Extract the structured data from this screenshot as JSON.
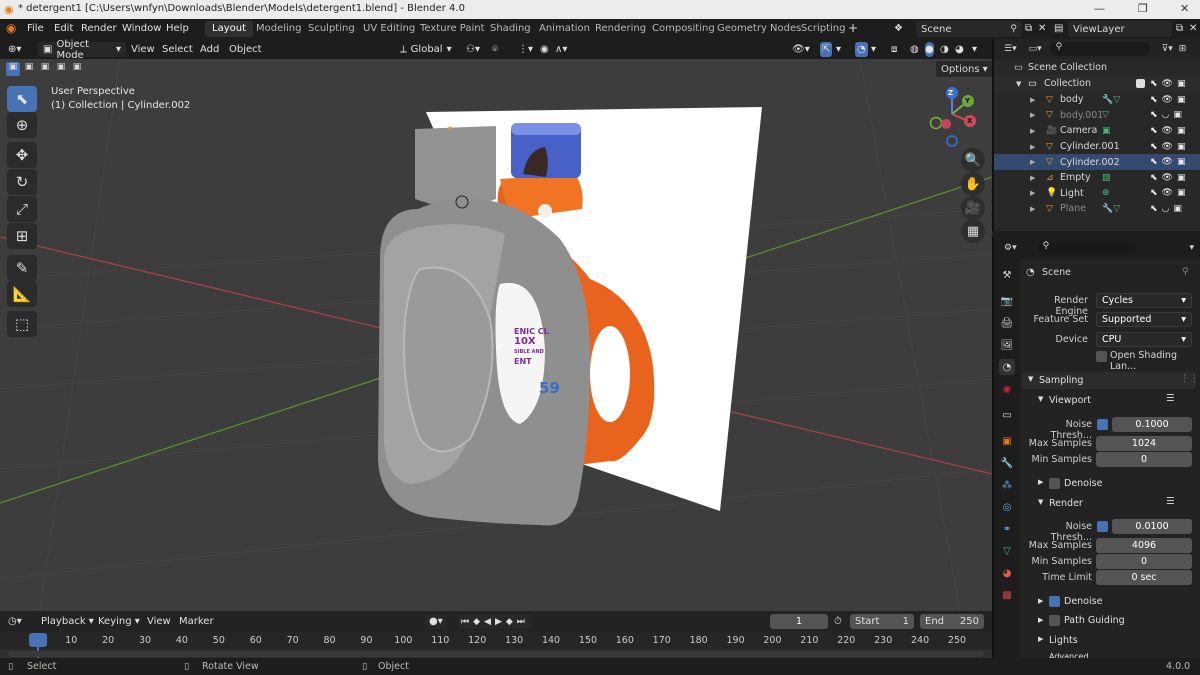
{
  "window": {
    "title": "* detergent1 [C:\\Users\\wnfyn\\Downloads\\Blender\\Models\\detergent1.blend] - Blender 4.0"
  },
  "menu": [
    "File",
    "Edit",
    "Render",
    "Window",
    "Help"
  ],
  "workspaces": [
    "Layout",
    "Modeling",
    "Sculpting",
    "UV Editing",
    "Texture Paint",
    "Shading",
    "Animation",
    "Rendering",
    "Compositing",
    "Geometry Nodes",
    "Scripting"
  ],
  "scene": {
    "name": "Scene",
    "view_layer": "ViewLayer"
  },
  "viewport_header": {
    "mode": "Object Mode",
    "menus": [
      "View",
      "Select",
      "Add",
      "Object"
    ],
    "transform": "Global",
    "options": "Options"
  },
  "viewport": {
    "info_line1": "User Perspective",
    "info_line2": "(1) Collection | Cylinder.002",
    "gizmo": {
      "z": "Z",
      "y": "Y",
      "x": "X"
    },
    "label_fragments": [
      "ENIC CL",
      "10X",
      "SIBLE AND",
      "ENT",
      "59"
    ]
  },
  "outliner": {
    "root": "Scene Collection",
    "collection": "Collection",
    "items": [
      {
        "name": "body",
        "color": "#e49a3a",
        "dim": false
      },
      {
        "name": "body.001",
        "color": "#e49a3a",
        "dim": true
      },
      {
        "name": "Camera",
        "color": "#e49a3a",
        "dim": false
      },
      {
        "name": "Cylinder.001",
        "color": "#e49a3a",
        "dim": false
      },
      {
        "name": "Cylinder.002",
        "color": "#e49a3a",
        "dim": false
      },
      {
        "name": "Empty",
        "color": "#e49a3a",
        "dim": false
      },
      {
        "name": "Light",
        "color": "#e49a3a",
        "dim": false
      },
      {
        "name": "Plane",
        "color": "#e49a3a",
        "dim": true
      }
    ]
  },
  "properties": {
    "context": "Scene",
    "render_engine_label": "Render Engine",
    "render_engine": "Cycles",
    "feature_set_label": "Feature Set",
    "feature_set": "Supported",
    "device_label": "Device",
    "device": "CPU",
    "open_shading": "Open Shading Lan...",
    "sampling": "Sampling",
    "viewport_section": "Viewport",
    "noise_threshold_label": "Noise Thresh...",
    "vp_noise_threshold": "0.1000",
    "max_samples_label": "Max Samples",
    "vp_max_samples": "1024",
    "min_samples_label": "Min Samples",
    "vp_min_samples": "0",
    "denoise": "Denoise",
    "render_section": "Render",
    "r_noise_threshold": "0.0100",
    "r_max_samples": "4096",
    "r_min_samples": "0",
    "time_limit_label": "Time Limit",
    "r_time_limit": "0 sec",
    "path_guiding": "Path Guiding",
    "lights": "Lights",
    "advanced": "Advanced"
  },
  "timeline": {
    "menus": [
      "Playback",
      "Keying",
      "View",
      "Marker"
    ],
    "current_frame": "1",
    "start_label": "Start",
    "start": "1",
    "end_label": "End",
    "end": "250",
    "frames": [
      "1",
      "10",
      "20",
      "30",
      "40",
      "50",
      "60",
      "70",
      "80",
      "90",
      "100",
      "110",
      "120",
      "130",
      "140",
      "150",
      "160",
      "170",
      "180",
      "190",
      "200",
      "210",
      "220",
      "230",
      "240",
      "250"
    ]
  },
  "status": {
    "select": "Select",
    "rotate": "Rotate View",
    "object": "Object",
    "version": "4.0.0"
  },
  "colors": {
    "accent": "#4772b3",
    "orange_bottle": "#e8641c",
    "grey_bottle": "#8e8e8e",
    "x_axis": "#c9424e",
    "y_axis": "#6e9b36"
  }
}
